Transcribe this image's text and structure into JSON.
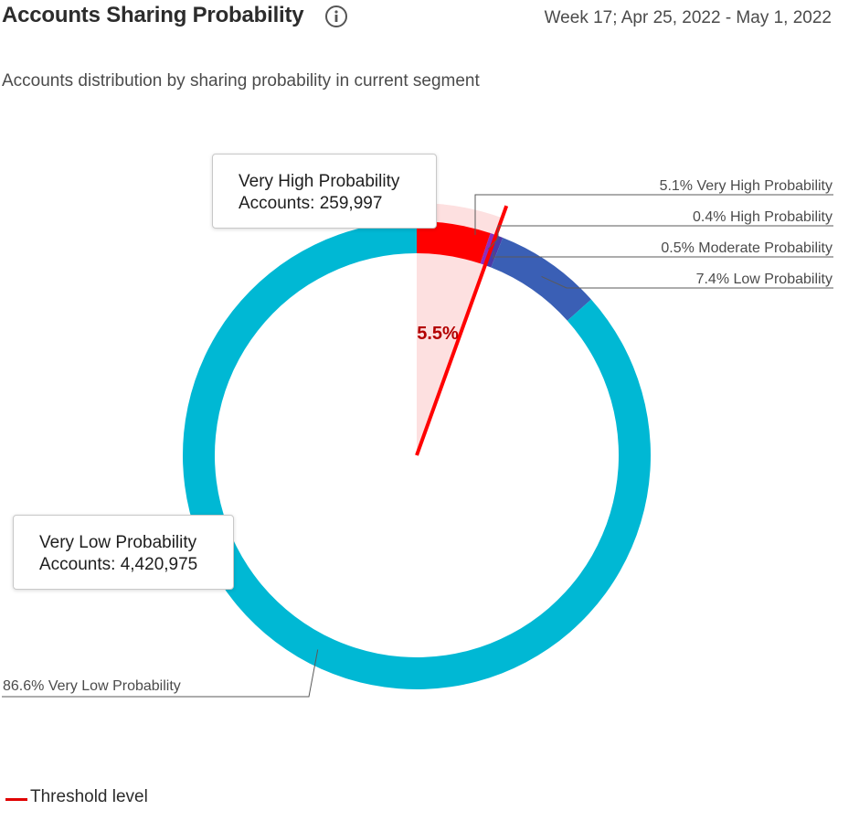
{
  "header": {
    "title": "Accounts Sharing Probability",
    "info_icon": "info-circle-icon",
    "date_range": "Week 17; Apr 25, 2022 - May 1, 2022"
  },
  "subtitle": "Accounts distribution by sharing probability in current segment",
  "chart_data": {
    "type": "pie",
    "variant": "donut",
    "series": [
      {
        "name": "Very High Probability",
        "percent": 5.1,
        "label": "5.1% Very High Probability",
        "color": "#ff0000"
      },
      {
        "name": "High Probability",
        "percent": 0.4,
        "label": "0.4% High Probability",
        "color": "#8b2fbf"
      },
      {
        "name": "Moderate Probability",
        "percent": 0.5,
        "label": "0.5% Moderate Probability",
        "color": "#4b3aa8"
      },
      {
        "name": "Low Probability",
        "percent": 7.4,
        "label": "7.4% Low Probability",
        "color": "#3a5fb5"
      },
      {
        "name": "Very Low Probability",
        "percent": 86.6,
        "label": "86.6% Very Low Probability",
        "color": "#00b8d4"
      }
    ],
    "threshold": {
      "percent": 5.5,
      "label": "5.5%",
      "color": "#ff0000",
      "area_color": "#fde0e0",
      "label_color": "#b30000"
    },
    "tooltips": [
      {
        "title": "Very High Probability",
        "detail": "Accounts: 259,997"
      },
      {
        "title": "Very Low Probability",
        "detail": "Accounts: 4,420,975"
      }
    ],
    "legend": {
      "label": "Threshold level",
      "color": "#e00000",
      "position": "bottom-left"
    }
  }
}
